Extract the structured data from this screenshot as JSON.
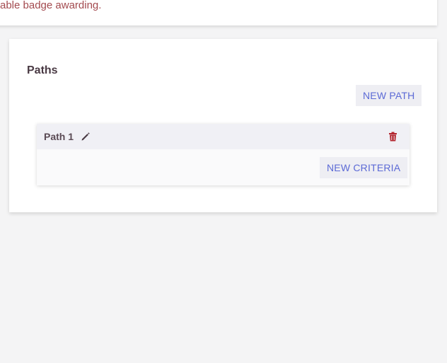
{
  "top_card": {
    "warning_text": "able badge awarding."
  },
  "paths_section": {
    "title": "Paths",
    "new_path_label": "NEW PATH",
    "paths": [
      {
        "name": "Path 1",
        "new_criteria_label": "NEW CRITERIA"
      }
    ]
  },
  "colors": {
    "background": "#f4f4f5",
    "card": "#ffffff",
    "accent": "#5c6ad6",
    "danger": "#b3262f",
    "warning_text": "#a34a4f"
  },
  "icons": {
    "edit": "pencil-icon",
    "delete": "trash-icon"
  }
}
